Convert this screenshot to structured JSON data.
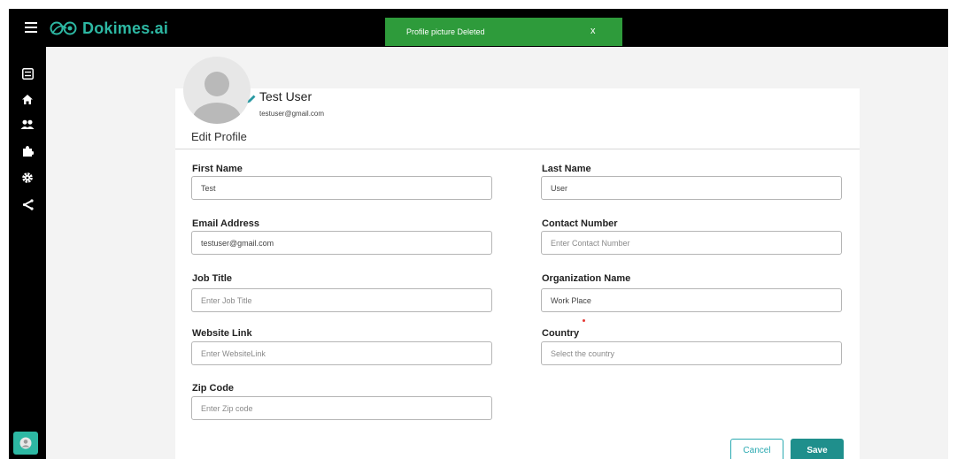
{
  "app": {
    "name": "Dokimes.ai",
    "brand_color": "#2db8a3"
  },
  "toast": {
    "message": "Profile picture Deleted",
    "close": "x",
    "color": "#2e9b3b"
  },
  "sidebar": {
    "icons": [
      "dashboard-icon",
      "home-icon",
      "users-icon",
      "puzzle-icon",
      "gear-icon",
      "share-icon",
      "user-avatar-icon"
    ]
  },
  "profile": {
    "name": "Test User",
    "email": "testuser@gmail.com",
    "section_title": "Edit Profile"
  },
  "form": {
    "first_name": {
      "label": "First Name",
      "value": "Test",
      "placeholder": ""
    },
    "last_name": {
      "label": "Last Name",
      "value": "User",
      "placeholder": ""
    },
    "email": {
      "label": "Email Address",
      "value": "testuser@gmail.com",
      "placeholder": ""
    },
    "contact": {
      "label": "Contact Number",
      "value": "",
      "placeholder": "Enter Contact Number"
    },
    "job_title": {
      "label": "Job Title",
      "value": "",
      "placeholder": "Enter Job Title"
    },
    "organization": {
      "label": "Organization Name",
      "value": "Work Place",
      "placeholder": ""
    },
    "website": {
      "label": "Website Link",
      "value": "",
      "placeholder": "Enter WebsiteLink"
    },
    "country": {
      "label": "Country",
      "value": "",
      "placeholder": "Select the country"
    },
    "zip": {
      "label": "Zip Code",
      "value": "",
      "placeholder": "Enter Zip code"
    }
  },
  "actions": {
    "cancel": "Cancel",
    "save": "Save",
    "accent": "#1f8f8c"
  }
}
